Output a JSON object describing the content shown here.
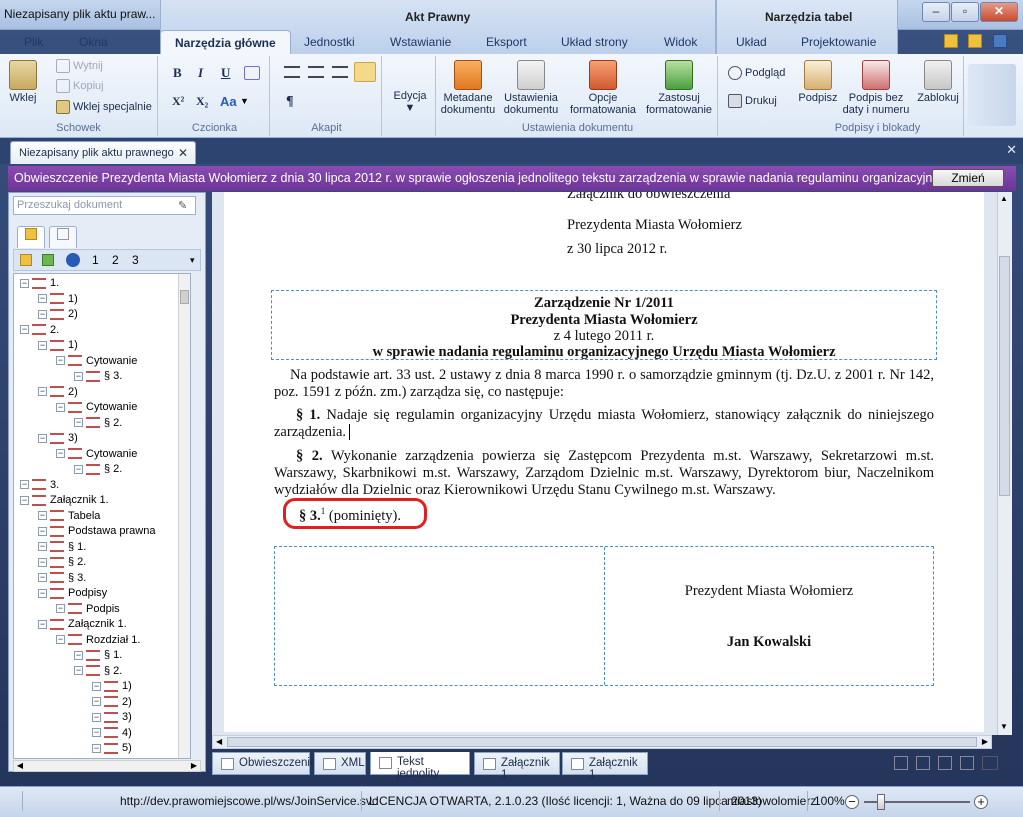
{
  "window": {
    "document_title": "Niezapisany plik aktu praw...",
    "app_title": "Akt Prawny",
    "context_title": "Narzędzia tabel"
  },
  "tabs": [
    "Plik",
    "Okna",
    "Narzędzia główne",
    "Jednostki",
    "Wstawianie",
    "Eksport",
    "Układ strony",
    "Widok",
    "Układ",
    "Projektowanie"
  ],
  "ribbon": {
    "schowek": {
      "label": "Schowek",
      "paste": "Wklej",
      "cut": "Wytnij",
      "copy": "Kopiuj",
      "paste_special": "Wklej specjalnie"
    },
    "czcionka": {
      "label": "Czcionka",
      "bold": "B",
      "italic": "I",
      "underline": "U",
      "superscript": "X²",
      "subscript": "X₂",
      "case": "Aa"
    },
    "akapit": {
      "label": "Akapit",
      "pilcrow": "¶"
    },
    "edycja": {
      "label": "Edycja"
    },
    "ustawienia": {
      "label": "Ustawienia dokumentu",
      "metadata": "Metadane dokumentu",
      "settings": "Ustawienia dokumentu",
      "options": "Opcje formatowania",
      "apply": "Zastosuj formatowanie"
    },
    "podglad": "Podgląd",
    "drukuj": "Drukuj",
    "podpisy": {
      "label": "Podpisy i blokady",
      "sign": "Podpisz",
      "sign_no_date": "Podpis bez daty i numeru",
      "lock": "Zablokuj"
    }
  },
  "doc_tab": "Niezapisany plik aktu prawnego",
  "notification": {
    "text": "Obwieszczenie Prezydenta Miasta Wołomierz z dnia 30 lipca 2012 r. w sprawie ogłoszenia jednolitego tekstu zarządzenia w sprawie nadania regulaminu organizacyjne...",
    "button": "Zmień"
  },
  "left_panel": {
    "search_placeholder": "Przeszukaj dokument",
    "levels": [
      "1",
      "2",
      "3"
    ],
    "tree": [
      {
        "label": "1.",
        "indent": 0
      },
      {
        "label": "1)",
        "indent": 1
      },
      {
        "label": "2)",
        "indent": 1
      },
      {
        "label": "2.",
        "indent": 0
      },
      {
        "label": "1)",
        "indent": 1
      },
      {
        "label": "Cytowanie",
        "indent": 2
      },
      {
        "label": "§ 3.",
        "indent": 3
      },
      {
        "label": "2)",
        "indent": 1
      },
      {
        "label": "Cytowanie",
        "indent": 2
      },
      {
        "label": "§ 2.",
        "indent": 3
      },
      {
        "label": "3)",
        "indent": 1
      },
      {
        "label": "Cytowanie",
        "indent": 2
      },
      {
        "label": "§ 2.",
        "indent": 3
      },
      {
        "label": "3.",
        "indent": 0
      },
      {
        "label": "Załącznik 1.",
        "indent": 0
      },
      {
        "label": "Tabela",
        "indent": 1
      },
      {
        "label": "Podstawa prawna",
        "indent": 1
      },
      {
        "label": "§ 1.",
        "indent": 1
      },
      {
        "label": "§ 2.",
        "indent": 1
      },
      {
        "label": "§ 3.",
        "indent": 1
      },
      {
        "label": "Podpisy",
        "indent": 1
      },
      {
        "label": "Podpis",
        "indent": 2
      },
      {
        "label": "Załącznik 1.",
        "indent": 1
      },
      {
        "label": "Rozdział 1.",
        "indent": 2
      },
      {
        "label": "§ 1.",
        "indent": 3
      },
      {
        "label": "§ 2.",
        "indent": 3
      },
      {
        "label": "1)",
        "indent": 4
      },
      {
        "label": "2)",
        "indent": 4
      },
      {
        "label": "3)",
        "indent": 4
      },
      {
        "label": "4)",
        "indent": 4
      },
      {
        "label": "5)",
        "indent": 4
      }
    ]
  },
  "document": {
    "attach1": "Załącznik do obwieszczenia",
    "attach2": "Prezydenta Miasta Wołomierz",
    "attach3": "z 30 lipca 2012 r.",
    "h1": "Zarządzenie Nr 1/2011",
    "h2": "Prezydenta Miasta Wołomierz",
    "h3": "z 4 lutego 2011 r.",
    "h4": "w sprawie nadania regulaminu organizacyjnego Urzędu Miasta Wołomierz",
    "basis": "Na podstawie art. 33 ust. 2 ustawy z dnia 8 marca 1990 r. o samorządzie gminnym (tj. Dz.U. z 2001 r. Nr 142, poz. 1591 z późn. zm.) zarządza się, co następuje:",
    "p1_mark": "§ 1.",
    "p1_text": "Nadaje się regulamin organizacyjny Urzędu miasta Wołomierz, stanowiący załącznik do niniejszego zarządzenia.",
    "p2_mark": "§ 2.",
    "p2_text": "Wykonanie zarządzenia powierza się Zastępcom Prezydenta m.st. Warszawy, Sekretarzowi m.st. Warszawy, Skarbnikowi m.st. Warszawy, Zarządom Dzielnic m.st. Warszawy, Dyrektorom biur, Naczelnikom wydziałów dla Dzielnic oraz Kierownikowi Urzędu Stanu Cywilnego m.st. Warszawy.",
    "p3_mark": "§ 3.",
    "p3_sup": "1",
    "p3_text": "(pominięty).",
    "sig_title": "Prezydent Miasta Wołomierz",
    "sig_name": "Jan Kowalski"
  },
  "bottom_tabs": [
    "Obwieszczenie",
    "XML",
    "Tekst jednolity",
    "Załącznik 1",
    "Załącznik 1"
  ],
  "status": {
    "url": "http://dev.prawomiejscowe.pl/ws/JoinService.svc",
    "license": "LICENCJA OTWARTA, 2.1.0.23 (Ilość licencji: 1, Ważna do 09 lipca 2013)",
    "user": "miastowolomierz",
    "zoom": "100%"
  },
  "colors": {
    "notification": "#7a3fa3",
    "highlight_ring": "#e02020",
    "dashed_border": "#4a90c8"
  }
}
